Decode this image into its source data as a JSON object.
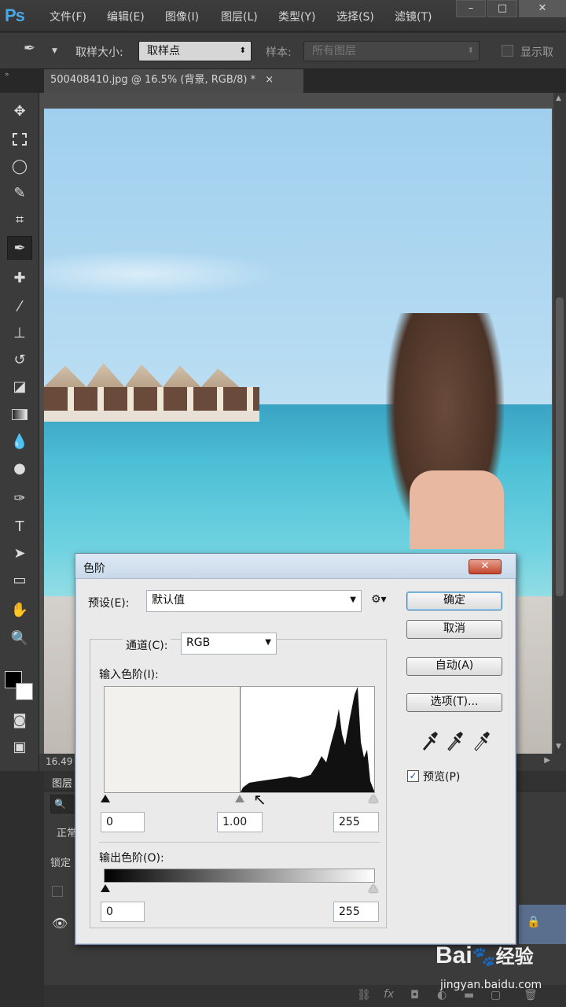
{
  "app": {
    "logo": "Ps"
  },
  "menu": [
    "文件(F)",
    "编辑(E)",
    "图像(I)",
    "图层(L)",
    "类型(Y)",
    "选择(S)",
    "滤镜(T)"
  ],
  "window_controls": [
    "–",
    "□",
    "✕"
  ],
  "options": {
    "sample_size_label": "取样大小:",
    "sample_size_value": "取样点",
    "sample_label": "样本:",
    "sample_value": "所有图层",
    "show_ring_label": "显示取"
  },
  "tab": {
    "title": "500408410.jpg @ 16.5% (背景, RGB/8) *",
    "close": "×"
  },
  "status": {
    "zoom": "16.49"
  },
  "layers_panel": {
    "title": "图层",
    "mode": "正常",
    "lock": "锁定"
  },
  "dialog": {
    "title": "色阶",
    "close": "✕",
    "preset_label": "预设(E):",
    "preset_value": "默认值",
    "channel_label": "通道(C):",
    "channel_value": "RGB",
    "input_levels_label": "输入色阶(I):",
    "input_values": [
      "0",
      "1.00",
      "255"
    ],
    "output_levels_label": "输出色阶(O):",
    "output_values": [
      "0",
      "255"
    ],
    "buttons": {
      "ok": "确定",
      "cancel": "取消",
      "auto": "自动(A)",
      "options": "选项(T)..."
    },
    "preview_label": "预览(P)",
    "preview_checked": true
  },
  "watermark": {
    "brand": "Bai",
    "brand2": "经验",
    "url": "jingyan.baidu.com"
  },
  "colors": {
    "ps_blue": "#4aa8e8",
    "dialog_bg": "#eaeaea",
    "title_bar": "#c9d9ea",
    "close_red": "#c4452c"
  }
}
